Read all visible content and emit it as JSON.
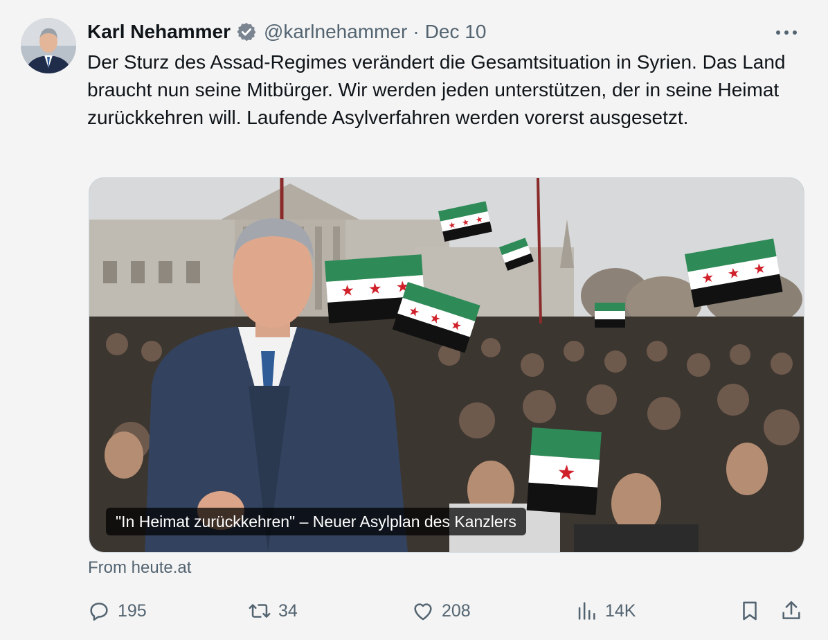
{
  "author": {
    "name": "Karl Nehammer",
    "handle": "@karlnehammer",
    "separator": "·",
    "date": "Dec 10"
  },
  "tweet": {
    "text": "Der Sturz des Assad-Regimes verändert die Gesamtsituation in Syrien. Das Land braucht nun seine Mitbürger. Wir werden jeden unterstützen, der in seine Heimat zurückkehren will. Laufende Asylverfahren werden vorerst ausgesetzt."
  },
  "card": {
    "caption": "\"In Heimat zurückkehren\" – Neuer Asylplan des Kanzlers",
    "source": "From heute.at"
  },
  "actions": {
    "replies": "195",
    "reposts": "34",
    "likes": "208",
    "views": "14K"
  },
  "icons": {
    "verified": "verified-badge-icon",
    "more": "more-dots-icon",
    "reply": "reply-icon",
    "repost": "repost-icon",
    "like": "heart-icon",
    "views": "views-chart-icon",
    "bookmark": "bookmark-icon",
    "share": "share-icon"
  },
  "colors": {
    "background": "#f4f4f4",
    "text": "#0f1419",
    "muted": "#536471",
    "flag_green": "#2e8b57",
    "flag_red": "#d0202a"
  }
}
